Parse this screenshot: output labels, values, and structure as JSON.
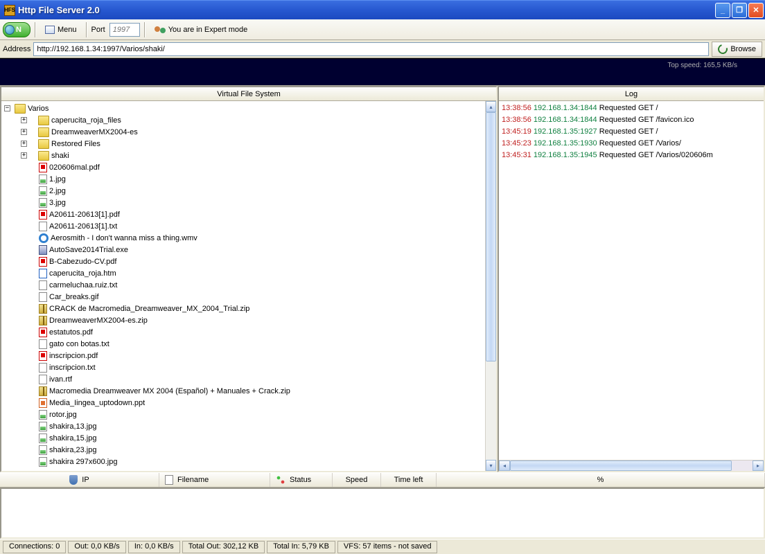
{
  "window": {
    "title": "Http File Server 2.0"
  },
  "toolbar": {
    "on_label": "N",
    "menu_label": "Menu",
    "port_label": "Port",
    "port_placeholder": "1997",
    "expert_label": "You are in Expert mode"
  },
  "addressbar": {
    "label": "Address",
    "value": "http://192.168.1.34:1997/Varios/shaki/",
    "browse_label": "Browse"
  },
  "graph": {
    "top_speed": "Top speed: 165,5 KB/s"
  },
  "vfs": {
    "header": "Virtual File System",
    "root": {
      "name": "Varios",
      "type": "folder",
      "expanded": true
    },
    "children": [
      {
        "name": "caperucita_roja_files",
        "type": "folder",
        "toggle": "+"
      },
      {
        "name": "DreamweaverMX2004-es",
        "type": "folder",
        "toggle": "+"
      },
      {
        "name": "Restored Files",
        "type": "folder",
        "toggle": "+"
      },
      {
        "name": "shaki",
        "type": "folder",
        "toggle": "+"
      },
      {
        "name": "020606mal.pdf",
        "type": "pdf"
      },
      {
        "name": "1.jpg",
        "type": "img"
      },
      {
        "name": "2.jpg",
        "type": "img"
      },
      {
        "name": "3.jpg",
        "type": "img"
      },
      {
        "name": "A20611-20613[1].pdf",
        "type": "pdf"
      },
      {
        "name": "A20611-20613[1].txt",
        "type": "txt"
      },
      {
        "name": "Aerosmith - I don't wanna miss a thing.wmv",
        "type": "wmv"
      },
      {
        "name": "AutoSave2014Trial.exe",
        "type": "exe"
      },
      {
        "name": "B-Cabezudo-CV.pdf",
        "type": "pdf"
      },
      {
        "name": "caperucita_roja.htm",
        "type": "htm"
      },
      {
        "name": "carmeluchaa.ruiz.txt",
        "type": "txt"
      },
      {
        "name": "Car_breaks.gif",
        "type": "gif"
      },
      {
        "name": "CRACK de Macromedia_Dreamweaver_MX_2004_Trial.zip",
        "type": "zip"
      },
      {
        "name": "DreamweaverMX2004-es.zip",
        "type": "zip"
      },
      {
        "name": "estatutos.pdf",
        "type": "pdf"
      },
      {
        "name": "gato con botas.txt",
        "type": "txt"
      },
      {
        "name": "inscripcion.pdf",
        "type": "pdf"
      },
      {
        "name": "inscripcion.txt",
        "type": "txt"
      },
      {
        "name": "ivan.rtf",
        "type": "txt"
      },
      {
        "name": "Macromedia Dreamweaver MX 2004 (Español) + Manuales + Crack.zip",
        "type": "zip"
      },
      {
        "name": "Media_Iingea_uptodown.ppt",
        "type": "ppt"
      },
      {
        "name": "rotor.jpg",
        "type": "img"
      },
      {
        "name": "shakira,13.jpg",
        "type": "img"
      },
      {
        "name": "shakira,15.jpg",
        "type": "img"
      },
      {
        "name": "shakira,23.jpg",
        "type": "img"
      },
      {
        "name": "shakira 297x600.jpg",
        "type": "img"
      }
    ]
  },
  "log": {
    "header": "Log",
    "lines": [
      {
        "time": "13:38:56",
        "ip": "192.168.1.34:1844",
        "msg": "Requested GET /"
      },
      {
        "time": "13:38:56",
        "ip": "192.168.1.34:1844",
        "msg": "Requested GET /favicon.ico"
      },
      {
        "time": "13:45:19",
        "ip": "192.168.1.35:1927",
        "msg": "Requested GET /"
      },
      {
        "time": "13:45:23",
        "ip": "192.168.1.35:1930",
        "msg": "Requested GET /Varios/"
      },
      {
        "time": "13:45:31",
        "ip": "192.168.1.35:1945",
        "msg": "Requested GET /Varios/020606m"
      }
    ]
  },
  "columns": {
    "ip": "IP",
    "filename": "Filename",
    "status": "Status",
    "speed": "Speed",
    "timeleft": "Time left",
    "percent": "%"
  },
  "status": {
    "connections": "Connections: 0",
    "out": "Out: 0,0 KB/s",
    "in": "In: 0,0 KB/s",
    "total_out": "Total Out: 302,12 KB",
    "total_in": "Total In: 5,79 KB",
    "vfs": "VFS: 57 items - not saved"
  }
}
